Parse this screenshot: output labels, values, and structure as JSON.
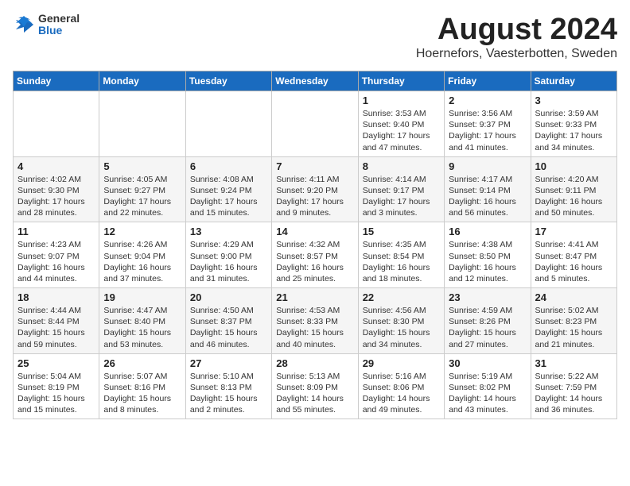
{
  "header": {
    "logo": {
      "general": "General",
      "blue": "Blue"
    },
    "title": "August 2024",
    "subtitle": "Hoernefors, Vaesterbotten, Sweden"
  },
  "days_of_week": [
    "Sunday",
    "Monday",
    "Tuesday",
    "Wednesday",
    "Thursday",
    "Friday",
    "Saturday"
  ],
  "weeks": [
    [
      {
        "day": "",
        "info": ""
      },
      {
        "day": "",
        "info": ""
      },
      {
        "day": "",
        "info": ""
      },
      {
        "day": "",
        "info": ""
      },
      {
        "day": "1",
        "info": "Sunrise: 3:53 AM\nSunset: 9:40 PM\nDaylight: 17 hours\nand 47 minutes."
      },
      {
        "day": "2",
        "info": "Sunrise: 3:56 AM\nSunset: 9:37 PM\nDaylight: 17 hours\nand 41 minutes."
      },
      {
        "day": "3",
        "info": "Sunrise: 3:59 AM\nSunset: 9:33 PM\nDaylight: 17 hours\nand 34 minutes."
      }
    ],
    [
      {
        "day": "4",
        "info": "Sunrise: 4:02 AM\nSunset: 9:30 PM\nDaylight: 17 hours\nand 28 minutes."
      },
      {
        "day": "5",
        "info": "Sunrise: 4:05 AM\nSunset: 9:27 PM\nDaylight: 17 hours\nand 22 minutes."
      },
      {
        "day": "6",
        "info": "Sunrise: 4:08 AM\nSunset: 9:24 PM\nDaylight: 17 hours\nand 15 minutes."
      },
      {
        "day": "7",
        "info": "Sunrise: 4:11 AM\nSunset: 9:20 PM\nDaylight: 17 hours\nand 9 minutes."
      },
      {
        "day": "8",
        "info": "Sunrise: 4:14 AM\nSunset: 9:17 PM\nDaylight: 17 hours\nand 3 minutes."
      },
      {
        "day": "9",
        "info": "Sunrise: 4:17 AM\nSunset: 9:14 PM\nDaylight: 16 hours\nand 56 minutes."
      },
      {
        "day": "10",
        "info": "Sunrise: 4:20 AM\nSunset: 9:11 PM\nDaylight: 16 hours\nand 50 minutes."
      }
    ],
    [
      {
        "day": "11",
        "info": "Sunrise: 4:23 AM\nSunset: 9:07 PM\nDaylight: 16 hours\nand 44 minutes."
      },
      {
        "day": "12",
        "info": "Sunrise: 4:26 AM\nSunset: 9:04 PM\nDaylight: 16 hours\nand 37 minutes."
      },
      {
        "day": "13",
        "info": "Sunrise: 4:29 AM\nSunset: 9:00 PM\nDaylight: 16 hours\nand 31 minutes."
      },
      {
        "day": "14",
        "info": "Sunrise: 4:32 AM\nSunset: 8:57 PM\nDaylight: 16 hours\nand 25 minutes."
      },
      {
        "day": "15",
        "info": "Sunrise: 4:35 AM\nSunset: 8:54 PM\nDaylight: 16 hours\nand 18 minutes."
      },
      {
        "day": "16",
        "info": "Sunrise: 4:38 AM\nSunset: 8:50 PM\nDaylight: 16 hours\nand 12 minutes."
      },
      {
        "day": "17",
        "info": "Sunrise: 4:41 AM\nSunset: 8:47 PM\nDaylight: 16 hours\nand 5 minutes."
      }
    ],
    [
      {
        "day": "18",
        "info": "Sunrise: 4:44 AM\nSunset: 8:44 PM\nDaylight: 15 hours\nand 59 minutes."
      },
      {
        "day": "19",
        "info": "Sunrise: 4:47 AM\nSunset: 8:40 PM\nDaylight: 15 hours\nand 53 minutes."
      },
      {
        "day": "20",
        "info": "Sunrise: 4:50 AM\nSunset: 8:37 PM\nDaylight: 15 hours\nand 46 minutes."
      },
      {
        "day": "21",
        "info": "Sunrise: 4:53 AM\nSunset: 8:33 PM\nDaylight: 15 hours\nand 40 minutes."
      },
      {
        "day": "22",
        "info": "Sunrise: 4:56 AM\nSunset: 8:30 PM\nDaylight: 15 hours\nand 34 minutes."
      },
      {
        "day": "23",
        "info": "Sunrise: 4:59 AM\nSunset: 8:26 PM\nDaylight: 15 hours\nand 27 minutes."
      },
      {
        "day": "24",
        "info": "Sunrise: 5:02 AM\nSunset: 8:23 PM\nDaylight: 15 hours\nand 21 minutes."
      }
    ],
    [
      {
        "day": "25",
        "info": "Sunrise: 5:04 AM\nSunset: 8:19 PM\nDaylight: 15 hours\nand 15 minutes."
      },
      {
        "day": "26",
        "info": "Sunrise: 5:07 AM\nSunset: 8:16 PM\nDaylight: 15 hours\nand 8 minutes."
      },
      {
        "day": "27",
        "info": "Sunrise: 5:10 AM\nSunset: 8:13 PM\nDaylight: 15 hours\nand 2 minutes."
      },
      {
        "day": "28",
        "info": "Sunrise: 5:13 AM\nSunset: 8:09 PM\nDaylight: 14 hours\nand 55 minutes."
      },
      {
        "day": "29",
        "info": "Sunrise: 5:16 AM\nSunset: 8:06 PM\nDaylight: 14 hours\nand 49 minutes."
      },
      {
        "day": "30",
        "info": "Sunrise: 5:19 AM\nSunset: 8:02 PM\nDaylight: 14 hours\nand 43 minutes."
      },
      {
        "day": "31",
        "info": "Sunrise: 5:22 AM\nSunset: 7:59 PM\nDaylight: 14 hours\nand 36 minutes."
      }
    ]
  ]
}
